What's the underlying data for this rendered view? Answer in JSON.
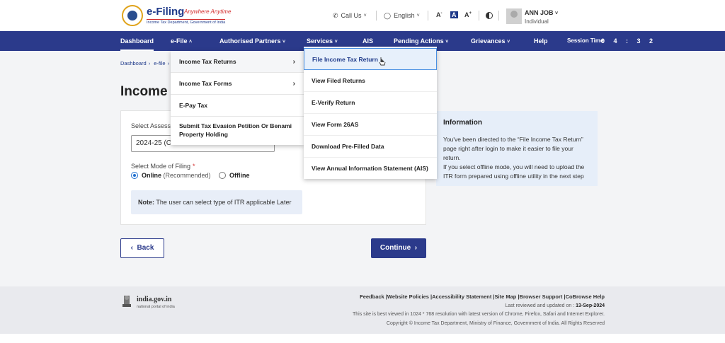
{
  "header": {
    "logo_title": "e-Filing",
    "logo_tagline": "Anywhere Anytime",
    "logo_subtitle": "Income Tax Department, Government of India",
    "call_us": "Call Us",
    "language": "English",
    "text_small": "A",
    "text_normal": "A",
    "text_large": "A",
    "user_name": "ANN JOB",
    "user_role": "Individual"
  },
  "nav": {
    "items": [
      "Dashboard",
      "e-File",
      "Authorised Partners",
      "Services",
      "AIS",
      "Pending Actions",
      "Grievances",
      "Help"
    ],
    "session_label": "Session Time",
    "session_time": "0 4 : 3 2"
  },
  "breadcrumb": [
    "Dashboard",
    "e-file"
  ],
  "page": {
    "title": "Income T",
    "assessment_label": "Select Assessm",
    "assessment_value": "2024-25  (Cu",
    "mode_label": "Select Mode of Filing",
    "mode_required": "*",
    "online_label": "Online",
    "online_rec": "(Recommended)",
    "offline_label": "Offline",
    "note_label": "Note:",
    "note_text": "The user can select type of ITR applicable Later",
    "back_label": "Back",
    "continue_label": "Continue"
  },
  "info": {
    "title": "Information",
    "text1": "You've been directed to the “File Income Tax Return” page right after login to make it easier to file your return.",
    "text2": "If you select offline mode, you will need to upload the ITR form prepared using offline utility in the next step"
  },
  "efile_menu": {
    "items": [
      "Income Tax Returns",
      "Income Tax Forms",
      "E-Pay Tax",
      "Submit Tax Evasion Petition Or Benami Property Holding"
    ]
  },
  "returns_menu": {
    "items": [
      "File Income Tax Return",
      "View Filed Returns",
      "E-Verify Return",
      "View Form 26AS",
      "Download Pre-Filled Data",
      "View Annual Information Statement (AIS)"
    ]
  },
  "footer": {
    "portal_name": "india.gov.in",
    "portal_sub": "national portal of india",
    "links": "Feedback |Website Policies |Accessibility Statement |Site Map |Browser Support |CoBrowse Help",
    "reviewed_label": "Last reviewed and updated on :",
    "reviewed_date": "13-Sep-2024",
    "best_viewed": "This site is best viewed in 1024 * 768 resolution with latest version of Chrome, Firefox, Safari and Internet Explorer.",
    "copyright": "Copyright © Income Tax Department, Ministry of Finance, Government of India. All Rights Reserved"
  },
  "colors": {
    "nav_bg": "#2b3a8b",
    "info_bg": "#e6eef9",
    "accent": "#1f6fd0"
  }
}
